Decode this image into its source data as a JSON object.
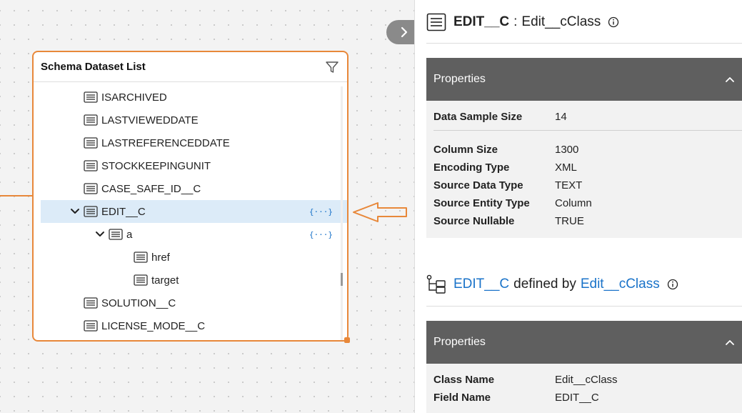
{
  "schema_card": {
    "title": "Schema Dataset List",
    "items": [
      {
        "label": "ISARCHIVED",
        "indent": 1
      },
      {
        "label": "LASTVIEWEDDATE",
        "indent": 1
      },
      {
        "label": "LASTREFERENCEDDATE",
        "indent": 1
      },
      {
        "label": "STOCKKEEPINGUNIT",
        "indent": 1
      },
      {
        "label": "CASE_SAFE_ID__C",
        "indent": 1
      },
      {
        "label": "EDIT__C",
        "indent": 1,
        "expanded": true,
        "selected": true,
        "badge": "{···}"
      },
      {
        "label": "a",
        "indent": 2,
        "expanded": true,
        "badge": "{···}"
      },
      {
        "label": "href",
        "indent": 3
      },
      {
        "label": "target",
        "indent": 3
      },
      {
        "label": "SOLUTION__C",
        "indent": 1
      },
      {
        "label": "LICENSE_MODE__C",
        "indent": 1
      }
    ]
  },
  "panel": {
    "title_name": "EDIT__C",
    "title_sep": ":",
    "title_class": "Edit__cClass",
    "properties_label": "Properties",
    "sample": {
      "key": "Data Sample Size",
      "value": "14"
    },
    "props": [
      {
        "key": "Column Size",
        "value": "1300"
      },
      {
        "key": "Encoding Type",
        "value": "XML"
      },
      {
        "key": "Source Data Type",
        "value": "TEXT"
      },
      {
        "key": "Source Entity Type",
        "value": "Column"
      },
      {
        "key": "Source Nullable",
        "value": "TRUE"
      }
    ],
    "defined": {
      "field": "EDIT__C",
      "text": "defined by",
      "class": "Edit__cClass"
    },
    "properties2_label": "Properties",
    "props2": [
      {
        "key": "Class Name",
        "value": "Edit__cClass"
      },
      {
        "key": "Field Name",
        "value": "EDIT__C"
      }
    ]
  },
  "colors": {
    "accent": "#e8883a",
    "link": "#1a73c9",
    "header_bg": "#5f5f5f",
    "selected_bg": "#dcebf8"
  }
}
